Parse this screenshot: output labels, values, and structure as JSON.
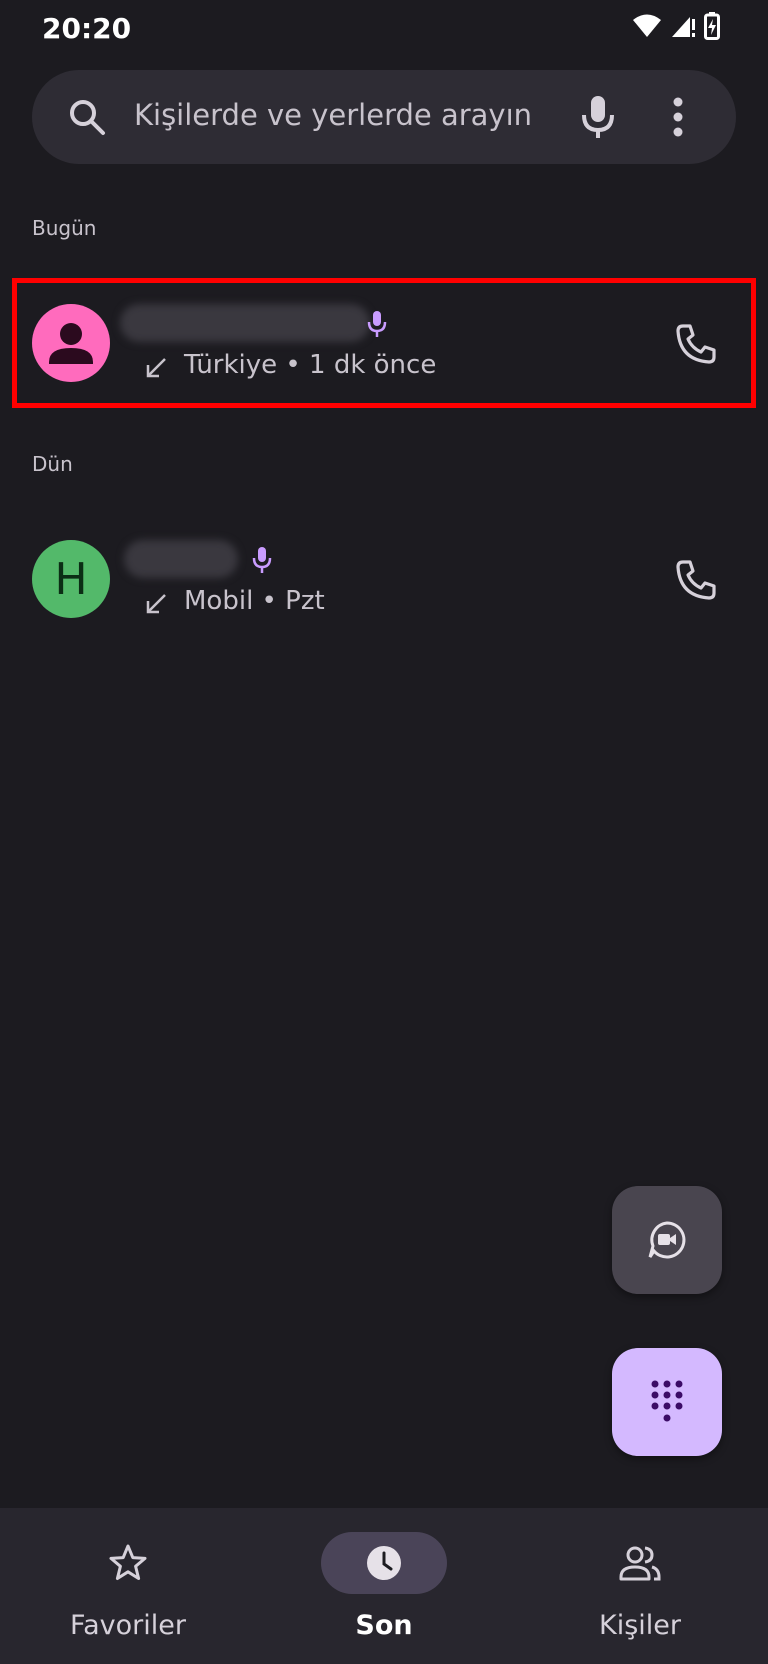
{
  "status_bar": {
    "time": "20:20"
  },
  "search": {
    "placeholder": "Kişilerde ve yerlerde arayın"
  },
  "sections": {
    "today": "Bugün",
    "yesterday": "Dün"
  },
  "calls": [
    {
      "avatar_color": "#ff6bbd",
      "avatar_letter": "",
      "meta": "Türkiye • 1 dk önce",
      "direction_icon": "incoming-call-icon"
    },
    {
      "avatar_color": "#53b96a",
      "avatar_letter": "H",
      "meta": "Mobil • Pzt",
      "direction_icon": "incoming-call-icon"
    }
  ],
  "bottom_nav": {
    "items": [
      {
        "label": "Favoriler",
        "icon": "star-icon",
        "active": false
      },
      {
        "label": "Son",
        "icon": "clock-icon",
        "active": true
      },
      {
        "label": "Kişiler",
        "icon": "people-icon",
        "active": false
      }
    ]
  },
  "colors": {
    "background": "#1c1b20",
    "accent_purple": "#d4b9ff",
    "highlight_red": "#ff0000"
  }
}
